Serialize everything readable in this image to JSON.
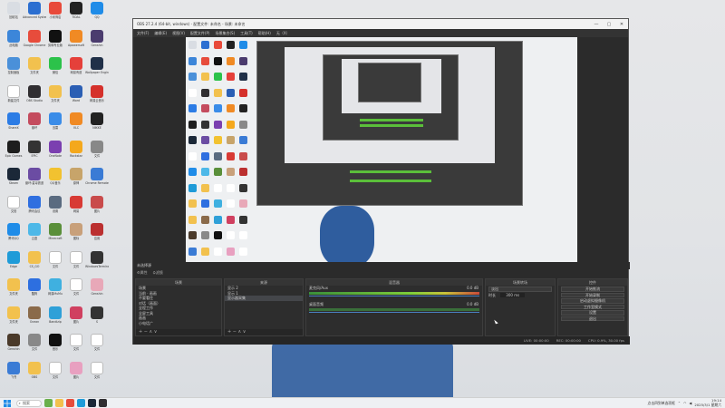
{
  "obs": {
    "title": "OBS 27.2.4 (64-bit, windows) - 配置文件: 未命名 - 场景: 未命名",
    "menu": [
      "文件(F)",
      "编辑(E)",
      "视图(V)",
      "配置文件(P)",
      "场景集合(S)",
      "工具(T)",
      "帮助(H)",
      "无（X）"
    ],
    "window_controls": [
      "—",
      "▢",
      "✕"
    ],
    "scene_label": "未选择源",
    "toolbar": [
      "⚙属性",
      "⛭滤镜"
    ],
    "docks": {
      "scenes": {
        "title": "场景",
        "items": [
          "场景",
          "当前 · 画画",
          "不要看住",
          "对话（画面）",
          "全程工作",
          "全屏工具",
          "画画",
          "小电话广"
        ]
      },
      "sources": {
        "title": "来源",
        "items": [
          "显示 2",
          "显示 1",
          "显示器采集"
        ]
      },
      "mixer": {
        "title": "混音器",
        "channels": [
          {
            "name": "麦克风/Aux",
            "db": "0.0 dB"
          },
          {
            "name": "桌面音频",
            "db": "0.0 dB"
          }
        ]
      },
      "transitions": {
        "title": "场景转场",
        "mode": "淡出",
        "duration_label": "时长",
        "duration_value": "300 ms"
      },
      "controls": {
        "title": "控件",
        "buttons": [
          "开始推流",
          "开始录制",
          "启动虚拟摄像机",
          "工作室模式",
          "设置",
          "退出"
        ]
      }
    },
    "status": [
      "LIVE: 00:00:00",
      "REC: 00:00:00",
      "CPU: 0.9%, 30.00 fps"
    ],
    "dock_foot": "+ − ∧ ∨"
  },
  "desktop_icons": [
    {
      "label": "回收站",
      "color": "#d9dde3"
    },
    {
      "label": "Advanced Systemcare",
      "color": "#2c6fd1"
    },
    {
      "label": "小米商店",
      "color": "#e84a3a"
    },
    {
      "label": "TIDAL",
      "color": "#222222"
    },
    {
      "label": "QQ",
      "color": "#1f8ce8"
    },
    {
      "label": "此电脑",
      "color": "#3c86d9"
    },
    {
      "label": "Google Chrome",
      "color": "#e74c3c"
    },
    {
      "label": "剪映专业版",
      "color": "#111111"
    },
    {
      "label": "Apowersoft",
      "color": "#f08a24"
    },
    {
      "label": "Genshin",
      "color": "#4b3c6e"
    },
    {
      "label": "控制面板",
      "color": "#4a90d9"
    },
    {
      "label": "文件夹",
      "color": "#f2c14e"
    },
    {
      "label": "微信",
      "color": "#2cc24a"
    },
    {
      "label": "网易有道",
      "color": "#e5403a"
    },
    {
      "label": "Wallpaper Engine",
      "color": "#203048"
    },
    {
      "label": "新建文件",
      "color": "#ffffff"
    },
    {
      "label": "OBS Studio",
      "color": "#302e31"
    },
    {
      "label": "文件夹",
      "color": "#f2c14e"
    },
    {
      "label": "Word",
      "color": "#2b5fb4"
    },
    {
      "label": "网易云音乐",
      "color": "#d5312b"
    },
    {
      "label": "ShareX",
      "color": "#2c7ce5"
    },
    {
      "label": "崩坏",
      "color": "#c44b5e"
    },
    {
      "label": "迅雷",
      "color": "#3a8ce8"
    },
    {
      "label": "VLC",
      "color": "#f08a24"
    },
    {
      "label": "NIKKE",
      "color": "#222222"
    },
    {
      "label": "Epic Games",
      "color": "#1e1e1e"
    },
    {
      "label": "EPIC",
      "color": "#333333"
    },
    {
      "label": "OneNote",
      "color": "#7b3fb0"
    },
    {
      "label": "Rockstar",
      "color": "#f4a81d"
    },
    {
      "label": "文件",
      "color": "#888888"
    },
    {
      "label": "Steam",
      "color": "#1b2838"
    },
    {
      "label": "崩坏:星穹铁道",
      "color": "#6b4ca3"
    },
    {
      "label": "QQ音乐",
      "color": "#f2c230"
    },
    {
      "label": "原神",
      "color": "#c7a46a"
    },
    {
      "label": "Chrome Remote",
      "color": "#3a7bd5"
    },
    {
      "label": "文档",
      "color": "#ffffff"
    },
    {
      "label": "腾讯会议",
      "color": "#2f6fe0"
    },
    {
      "label": "设置",
      "color": "#5a6b80"
    },
    {
      "label": "网易",
      "color": "#d83a34"
    },
    {
      "label": "图片",
      "color": "#c94b4b"
    },
    {
      "label": "腾讯QQ",
      "color": "#1f8ce8"
    },
    {
      "label": "云盘",
      "color": "#4db8e8"
    },
    {
      "label": "Minecraft",
      "color": "#5a8f3a"
    },
    {
      "label": "图标",
      "color": "#c8a07a"
    },
    {
      "label": "应用",
      "color": "#bb3030"
    },
    {
      "label": "Edge",
      "color": "#1f9bd8"
    },
    {
      "label": "CS_GO",
      "color": "#f2c14e"
    },
    {
      "label": "文件",
      "color": "#ffffff"
    },
    {
      "label": "文件",
      "color": "#ffffff"
    },
    {
      "label": "WindowsTerminal",
      "color": "#333333"
    },
    {
      "label": "文件夹",
      "color": "#f2c14e"
    },
    {
      "label": "酷狗",
      "color": "#2d6fe0"
    },
    {
      "label": "网易MuMu",
      "color": "#3fb0e0"
    },
    {
      "label": "文件",
      "color": "#ffffff"
    },
    {
      "label": "Genshin",
      "color": "#e8a8b8"
    },
    {
      "label": "文件夹",
      "color": "#f2c14e"
    },
    {
      "label": "Ocean",
      "color": "#8a6a4a"
    },
    {
      "label": "Bandizip",
      "color": "#2fa0d8"
    },
    {
      "label": "图片",
      "color": "#d04060"
    },
    {
      "label": "S",
      "color": "#333333"
    },
    {
      "label": "Genshin",
      "color": "#4a3a2a"
    },
    {
      "label": "文件",
      "color": "#888888"
    },
    {
      "label": "音乐",
      "color": "#111111"
    },
    {
      "label": "文件",
      "color": "#ffffff"
    },
    {
      "label": "文件",
      "color": "#ffffff"
    },
    {
      "label": "飞书",
      "color": "#3a7bd5"
    },
    {
      "label": "OBS",
      "color": "#f2c14e"
    },
    {
      "label": "文件",
      "color": "#ffffff"
    },
    {
      "label": "图片",
      "color": "#e8a0c0"
    },
    {
      "label": "文件",
      "color": "#ffffff"
    }
  ],
  "taskbar": {
    "search": "搜索",
    "apps": [
      {
        "name": "widgets",
        "color": "#6ab04c"
      },
      {
        "name": "file-explorer",
        "color": "#f2c14e"
      },
      {
        "name": "chrome",
        "color": "#e74c3c"
      },
      {
        "name": "edge",
        "color": "#1f9bd8"
      },
      {
        "name": "steam",
        "color": "#1b2838"
      },
      {
        "name": "obs",
        "color": "#302e31"
      }
    ],
    "tray_text": "点击四到单选项框",
    "time": "19:14",
    "date": "2025/3/1 星期六"
  },
  "colors": {
    "obs_bg": "#2b2b2b",
    "desktop_bg": "#e6e7e9",
    "accent_blue": "#2f5d9e"
  }
}
